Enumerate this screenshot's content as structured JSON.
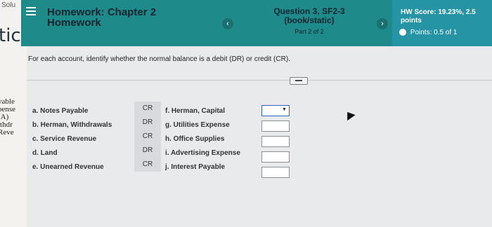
{
  "left_strip": {
    "top_text": "Solu",
    "large_text": "tic",
    "lines": [
      "yable",
      "pense",
      "(A)",
      "ithdr",
      "Reve"
    ]
  },
  "header": {
    "title_line1": "Homework: Chapter 2",
    "title_line2": "Homework",
    "question_line1": "Question 3, SF2-3",
    "question_line2": "(book/static)",
    "part": "Part 2 of 2",
    "score_line1": "HW Score: 19.23%, 2.5",
    "score_line2": "points",
    "points": "Points: 0.5 of 1",
    "prev_icon": "‹",
    "next_icon": "›"
  },
  "question": {
    "instruction": "For each account, identify whether the normal balance is a debit (DR) or credit (CR)."
  },
  "items_left": [
    "a. Notes Payable",
    "b. Herman, Withdrawals",
    "c. Service Revenue",
    "d. Land",
    "e. Unearned Revenue"
  ],
  "codes": [
    "CR",
    "DR",
    "CR",
    "DR",
    "CR"
  ],
  "items_right": [
    "f. Herman, Capital",
    "g. Utilities Expense",
    "h. Office Supplies",
    "i. Advertising Expense",
    "j. Interest Payable"
  ],
  "answers": [
    {
      "value": ""
    },
    {
      "value": ""
    },
    {
      "value": ""
    },
    {
      "value": ""
    },
    {
      "value": ""
    }
  ]
}
